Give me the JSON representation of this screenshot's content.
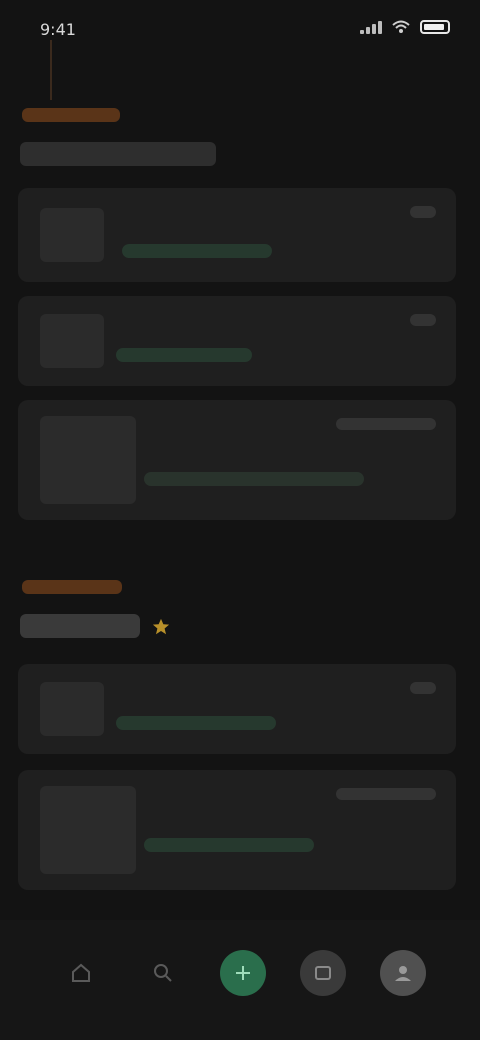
{
  "status_bar": {
    "time": "9:41"
  },
  "sections": [
    {
      "eyebrow": "",
      "title": "",
      "cards": [
        {
          "time": "",
          "text": ""
        },
        {
          "time": "",
          "text": ""
        },
        {
          "time": "",
          "text": ""
        }
      ]
    },
    {
      "eyebrow": "",
      "title": "",
      "cards": [
        {
          "time": "",
          "text": ""
        },
        {
          "time": "",
          "text": ""
        }
      ]
    }
  ],
  "bottom_nav": {
    "items": [
      {
        "icon": "home-icon",
        "label": ""
      },
      {
        "icon": "search-icon",
        "label": ""
      },
      {
        "icon": "plus-icon",
        "label": ""
      },
      {
        "icon": "inbox-icon",
        "label": ""
      },
      {
        "icon": "profile-icon",
        "label": ""
      }
    ]
  },
  "colors": {
    "background": "#131313",
    "card": "#1f1f1f",
    "accent_orange": "#c9682b",
    "accent_green": "#2a6e4c",
    "link_green": "#7fbf97"
  }
}
